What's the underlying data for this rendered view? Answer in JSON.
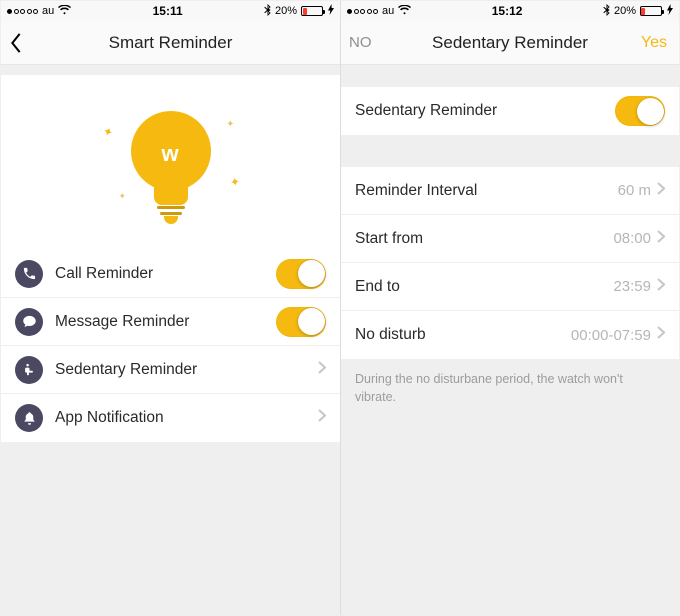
{
  "left": {
    "status": {
      "carrier": "au",
      "time": "15:11",
      "battery_pct": "20%"
    },
    "nav": {
      "title": "Smart Reminder"
    },
    "rows": {
      "call": {
        "label": "Call Reminder"
      },
      "message": {
        "label": "Message Reminder"
      },
      "sedentary": {
        "label": "Sedentary Reminder"
      },
      "appnotif": {
        "label": "App Notification"
      }
    }
  },
  "right": {
    "status": {
      "carrier": "au",
      "time": "15:12",
      "battery_pct": "20%"
    },
    "nav": {
      "title": "Sedentary Reminder",
      "left": "NO",
      "right": "Yes"
    },
    "toggle_row": {
      "label": "Sedentary Reminder"
    },
    "settings": {
      "interval": {
        "label": "Reminder Interval",
        "value": "60 m"
      },
      "start": {
        "label": "Start from",
        "value": "08:00"
      },
      "end": {
        "label": "End to",
        "value": "23:59"
      },
      "nodisturb": {
        "label": "No disturb",
        "value": "00:00-07:59"
      }
    },
    "footnote": "During the no disturbane period, the watch won't vibrate."
  }
}
